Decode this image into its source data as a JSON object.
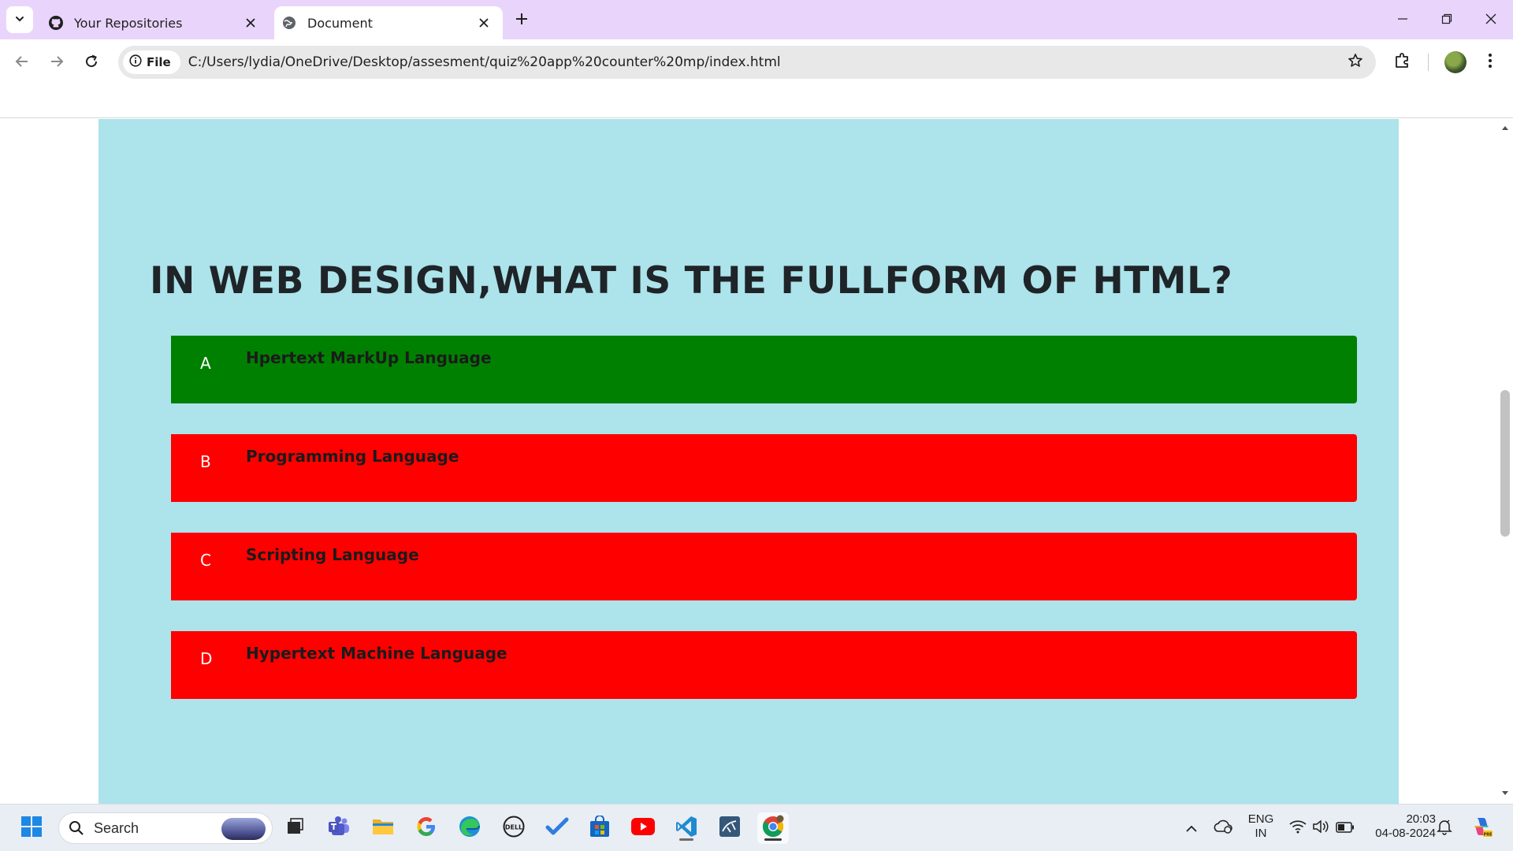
{
  "browser": {
    "tabs": [
      {
        "title": "Your Repositories",
        "active": false,
        "icon": "github-icon"
      },
      {
        "title": "Document",
        "active": true,
        "icon": "globe-icon"
      }
    ],
    "address": {
      "chip_label": "File",
      "url": "C:/Users/lydia/OneDrive/Desktop/assesment/quiz%20app%20counter%20mp/index.html"
    }
  },
  "quiz": {
    "question": "IN WEB DESIGN,WHAT IS THE FULLFORM OF HTML?",
    "options": [
      {
        "letter": "A",
        "text": "Hpertext MarkUp Language",
        "state": "correct",
        "color": "#008000"
      },
      {
        "letter": "B",
        "text": "Programming Language",
        "state": "incorrect",
        "color": "#ff0000"
      },
      {
        "letter": "C",
        "text": "Scripting Language",
        "state": "incorrect",
        "color": "#ff0000"
      },
      {
        "letter": "D",
        "text": "Hypertext Machine Language",
        "state": "incorrect",
        "color": "#ff0000"
      }
    ],
    "panel_color": "#ade3ea"
  },
  "taskbar": {
    "search_label": "Search",
    "language_line1": "ENG",
    "language_line2": "IN",
    "time": "20:03",
    "date": "04-08-2024"
  }
}
